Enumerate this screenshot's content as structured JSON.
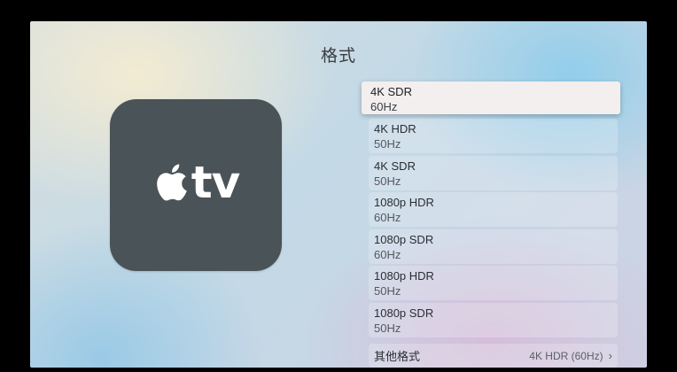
{
  "screen": {
    "title": "格式"
  },
  "tile": {
    "logo_text": "tv"
  },
  "options": {
    "selected": {
      "label": "4K SDR",
      "rate": "60Hz"
    },
    "items": [
      {
        "label": "4K HDR",
        "rate": "50Hz"
      },
      {
        "label": "4K SDR",
        "rate": "50Hz"
      },
      {
        "label": "1080p HDR",
        "rate": "60Hz"
      },
      {
        "label": "1080p SDR",
        "rate": "60Hz"
      },
      {
        "label": "1080p HDR",
        "rate": "50Hz"
      },
      {
        "label": "1080p SDR",
        "rate": "50Hz"
      }
    ]
  },
  "other": {
    "label": "其他格式",
    "value": "4K HDR (60Hz)",
    "chevron": "›"
  },
  "icons": {
    "logo": "apple-icon",
    "more": "chevron-right-icon"
  },
  "colors": {
    "tile": "#4a5358",
    "selected_bg": "#f2efee"
  }
}
